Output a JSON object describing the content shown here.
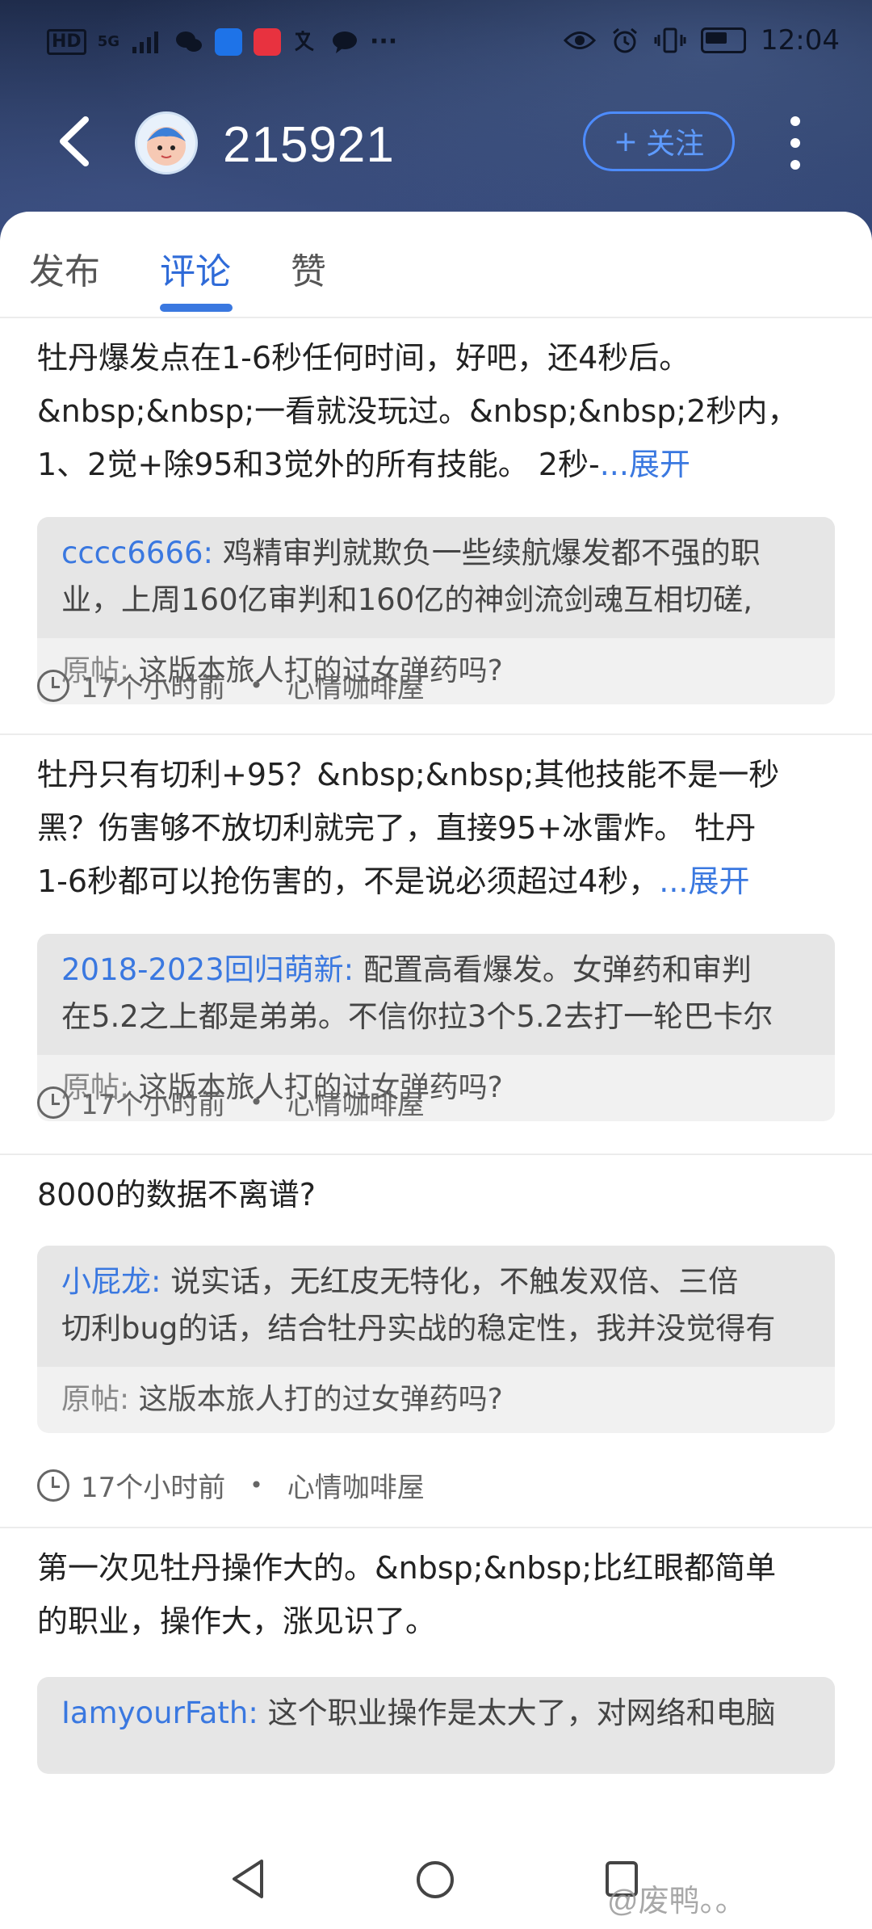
{
  "status_bar": {
    "network": "HD",
    "signal": "5G",
    "dots": "···",
    "time": "12:04"
  },
  "header": {
    "username": "215921",
    "follow_plus": "+",
    "follow_label": "关注"
  },
  "tabs": [
    {
      "label": "发布",
      "active": false
    },
    {
      "label": "评论",
      "active": true
    },
    {
      "label": "赞",
      "active": false
    }
  ],
  "posts": [
    {
      "text_lines": [
        "牡丹爆发点在1-6秒任何时间，好吧，还4秒后。",
        "&nbsp;&nbsp;一看就没玩过。&nbsp;&nbsp;2秒内，",
        "1、2觉+除95和3觉外的所有技能。 2秒-"
      ],
      "expand_label": "...展开",
      "reply_user": "cccc6666:",
      "reply_lines": [
        "鸡精审判就欺负一些续航爆发都不强的职",
        "业，上周160亿审判和160亿的神剑流剑魂互相切磋,"
      ],
      "orig_label": "原帖:",
      "orig_title": "这版本旅人打的过女弹药吗?",
      "time": "17个小时前",
      "dot": "•",
      "forum": "心情咖啡屋"
    },
    {
      "text_lines": [
        "牡丹只有切利+95？&nbsp;&nbsp;其他技能不是一秒",
        "黑？伤害够不放切利就完了，直接95+冰雷炸。 牡丹",
        "1-6秒都可以抢伤害的，不是说必须超过4秒，"
      ],
      "expand_label": "...展开",
      "reply_user": "2018-2023回归萌新:",
      "reply_lines": [
        "配置高看爆发。女弹药和审判",
        "在5.2之上都是弟弟。不信你拉3个5.2去打一轮巴卡尔"
      ],
      "orig_label": "原帖:",
      "orig_title": "这版本旅人打的过女弹药吗?",
      "time": "17个小时前",
      "dot": "•",
      "forum": "心情咖啡屋"
    },
    {
      "text_lines": [
        "8000的数据不离谱?"
      ],
      "expand_label": "",
      "reply_user": "小屁龙:",
      "reply_lines": [
        "说实话，无红皮无特化，不触发双倍、三倍",
        "切利bug的话，结合牡丹实战的稳定性，我并没觉得有"
      ],
      "orig_label": "原帖:",
      "orig_title": "这版本旅人打的过女弹药吗?",
      "time": "17个小时前",
      "dot": "•",
      "forum": "心情咖啡屋"
    },
    {
      "text_lines": [
        "第一次见牡丹操作大的。&nbsp;&nbsp;比红眼都简单",
        "的职业，操作大，涨见识了。"
      ],
      "expand_label": "",
      "reply_user": "IamyourFath:",
      "reply_lines": [
        "这个职业操作是太大了，对网络和电脑"
      ],
      "orig_label": "",
      "orig_title": "",
      "time": "",
      "dot": "",
      "forum": ""
    }
  ],
  "watermark": "@废鸭。。",
  "colors": {
    "accent": "#3a78e0",
    "header_bg": "#2a3b62",
    "quote_bg": "#e6e6e6",
    "orig_bg": "#f1f1f1"
  }
}
